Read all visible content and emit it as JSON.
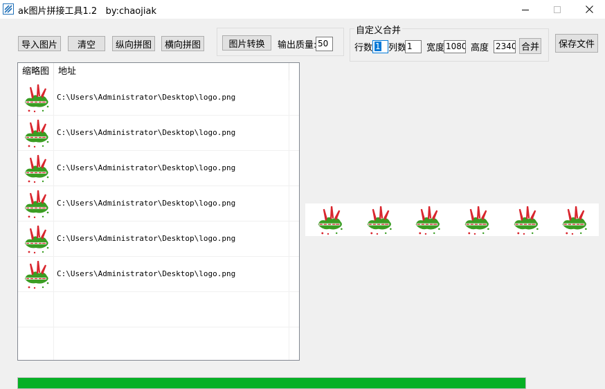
{
  "window": {
    "title": "ak图片拼接工具1.2   by:chaojiak"
  },
  "toolbar": {
    "import_label": "导入图片",
    "clear_label": "清空",
    "vertical_label": "纵向拼图",
    "horizontal_label": "横向拼图",
    "convert_label": "图片转换",
    "quality_label": "输出质量:",
    "quality_value": "50",
    "save_label": "保存文件"
  },
  "custom_merge": {
    "group_title": "自定义合并",
    "rows_label": "行数",
    "rows_value": "1",
    "cols_label": "列数",
    "cols_value": "1",
    "width_label": "宽度",
    "width_value": "1080",
    "height_label": "高度",
    "height_value": "2340",
    "merge_label": "合并"
  },
  "list": {
    "columns": [
      "缩略图",
      "地址"
    ],
    "rows": [
      {
        "path": "C:\\Users\\Administrator\\Desktop\\logo.png"
      },
      {
        "path": "C:\\Users\\Administrator\\Desktop\\logo.png"
      },
      {
        "path": "C:\\Users\\Administrator\\Desktop\\logo.png"
      },
      {
        "path": "C:\\Users\\Administrator\\Desktop\\logo.png"
      },
      {
        "path": "C:\\Users\\Administrator\\Desktop\\logo.png"
      },
      {
        "path": "C:\\Users\\Administrator\\Desktop\\logo.png"
      }
    ]
  },
  "preview": {
    "tile_count": 6
  },
  "progress": {
    "fraction": 1.0
  },
  "colors": {
    "progress_fill": "#06b025",
    "accent": "#0078d7",
    "logo_green": "#3a9d23",
    "logo_red": "#d9262e"
  }
}
